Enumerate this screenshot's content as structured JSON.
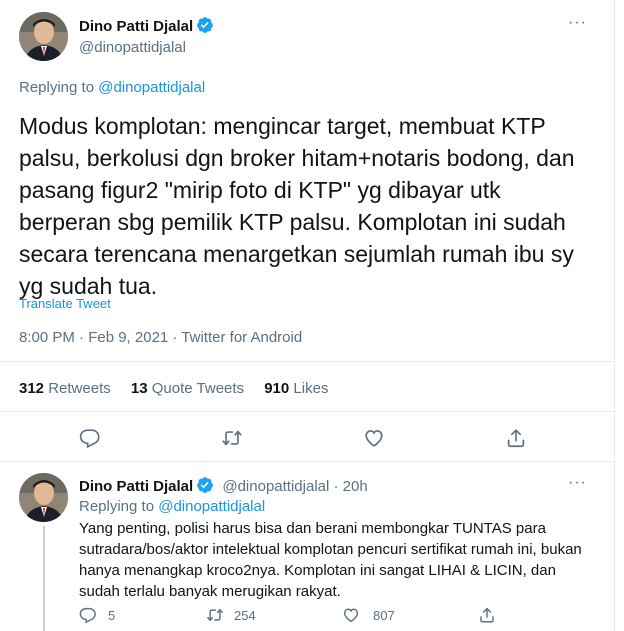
{
  "main_tweet": {
    "author_name": "Dino Patti Djalal",
    "author_handle": "@dinopattidjalal",
    "replying_prefix": "Replying to",
    "replying_to": "@dinopattidjalal",
    "text": "Modus komplotan: mengincar target, membuat KTP palsu, berkolusi dgn broker hitam+notaris bodong, dan pasang figur2 \"mirip foto di KTP\" yg dibayar utk berperan sbg pemilik KTP palsu. Komplotan ini sudah secara terencana menargetkan sejumlah rumah ibu sy yg sudah tua.",
    "translate_label": "Translate Tweet",
    "timestamp": "8:00 PM · Feb 9, 2021 · Twitter for Android",
    "stats": {
      "retweets_count": "312",
      "retweets_label": "Retweets",
      "quotes_count": "13",
      "quotes_label": "Quote Tweets",
      "likes_count": "910",
      "likes_label": "Likes"
    }
  },
  "reply_tweet": {
    "author_name": "Dino Patti Djalal",
    "author_handle": "@dinopattidjalal",
    "time_ago": "· 20h",
    "replying_prefix": "Replying to",
    "replying_to": "@dinopattidjalal",
    "text": "Yang penting, polisi harus bisa dan berani membongkar TUNTAS para sutradara/bos/aktor intelektual komplotan pencuri sertifikat rumah ini, bukan hanya menangkap kroco2nya. Komplotan ini sangat LIHAI & LICIN, dan sudah terlalu banyak merugikan rakyat.",
    "reply_count": "5",
    "retweet_count": "254",
    "like_count": "807"
  },
  "colors": {
    "accent": "#1b95e0",
    "verified": "#1da1f2",
    "muted": "#5b7083",
    "divider": "#e6ecf0"
  },
  "icons": [
    "verified-badge-icon",
    "more-icon",
    "reply-icon",
    "retweet-icon",
    "like-icon",
    "share-icon"
  ]
}
